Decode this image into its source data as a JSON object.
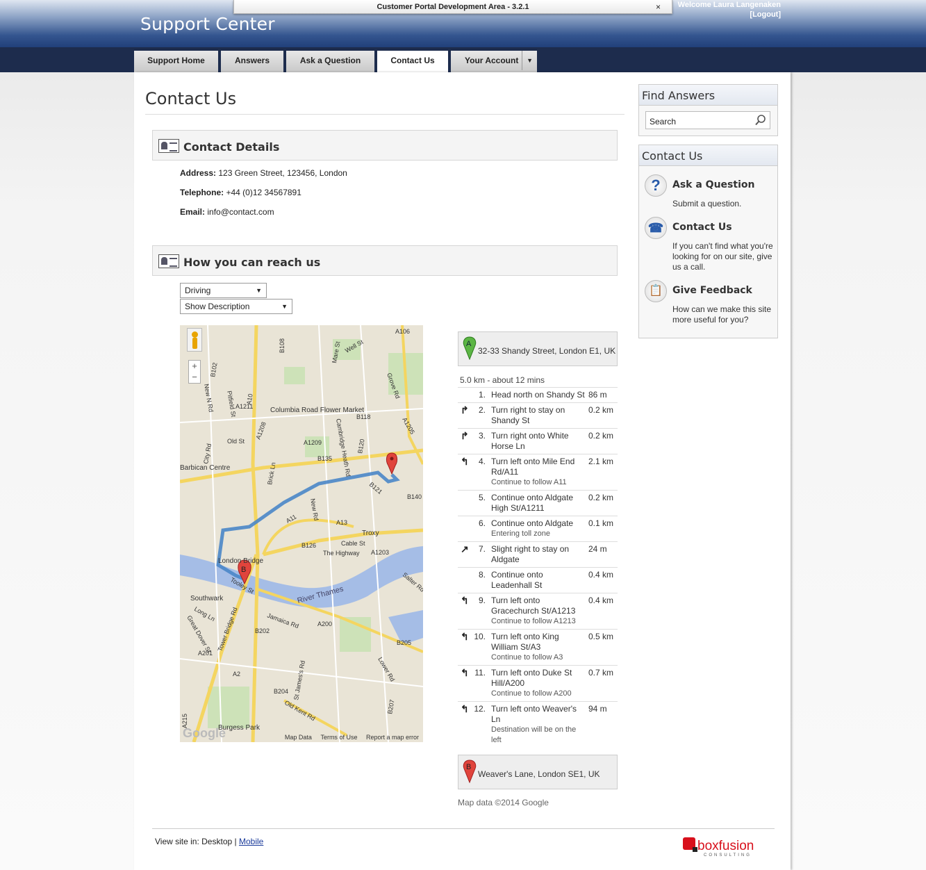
{
  "header": {
    "brand": "Support Center",
    "dev_title": "Customer Portal Development Area - 3.2.1",
    "dev_close": "×",
    "welcome": "Welcome Laura Langenaken",
    "logout": "[Logout]"
  },
  "nav": {
    "tabs": [
      {
        "label": "Support Home"
      },
      {
        "label": "Answers"
      },
      {
        "label": "Ask a Question"
      },
      {
        "label": "Contact Us"
      },
      {
        "label": "Your Account"
      }
    ],
    "active": "Contact Us"
  },
  "page": {
    "title": "Contact Us"
  },
  "contact": {
    "heading": "Contact Details",
    "address_label": "Address:",
    "address": "123 Green Street, 123456, London",
    "phone_label": "Telephone:",
    "phone": "+44 (0)12 34567891",
    "email_label": "Email:",
    "email": "info@contact.com"
  },
  "reach": {
    "heading": "How you can reach us",
    "mode": "Driving",
    "desc": "Show Description"
  },
  "map": {
    "labels": [
      "Columbia Road Flower Market",
      "Barbican Centre",
      "London Bridge",
      "Southwark",
      "Troxy",
      "River Thames",
      "The Highway",
      "Cable St",
      "Burgess Park",
      "Old St",
      "City Rd",
      "Tower Bridge Rd",
      "Jamaica Rd",
      "Long Ln",
      "Lower Rd",
      "Salter Rd",
      "Old Kent Rd",
      "Great Dover St",
      "St James's Rd"
    ],
    "roads": [
      "A10",
      "A1208",
      "A1209",
      "B135",
      "B108",
      "B118",
      "B120",
      "A1205",
      "A106",
      "B102",
      "A11",
      "A13",
      "B126",
      "A1203",
      "B121",
      "B140",
      "B202",
      "A200",
      "B205",
      "A201",
      "A2",
      "B204",
      "B207",
      "A215",
      "A1211",
      "Well St",
      "Mare St",
      "Grove Rd",
      "New N Rd",
      "Pitfield St",
      "Brick Ln",
      "New Rd",
      "Cambridge Heath Rd",
      "Tooley St"
    ],
    "google": "Google",
    "footer": [
      "Map Data",
      "Terms of Use",
      "Report a map error"
    ],
    "marker_b": "B",
    "zoom_in": "+",
    "zoom_out": "−"
  },
  "directions": {
    "start_pin": "A",
    "start": "32-33 Shandy Street, London E1, UK",
    "summary": "5.0 km - about 12 mins",
    "steps": [
      {
        "icon": "",
        "num": "1.",
        "text": "Head north on Shandy St",
        "sub": "",
        "dist": "86 m"
      },
      {
        "icon": "turn-right-icon",
        "num": "2.",
        "text": "Turn right to stay on Shandy St",
        "sub": "",
        "dist": "0.2 km"
      },
      {
        "icon": "turn-right-icon",
        "num": "3.",
        "text": "Turn right onto White Horse Ln",
        "sub": "",
        "dist": "0.2 km"
      },
      {
        "icon": "turn-left-icon",
        "num": "4.",
        "text": "Turn left onto Mile End Rd/A11",
        "sub": "Continue to follow A11",
        "dist": "2.1 km"
      },
      {
        "icon": "",
        "num": "5.",
        "text": "Continue onto Aldgate High St/A1211",
        "sub": "",
        "dist": "0.2 km"
      },
      {
        "icon": "",
        "num": "6.",
        "text": "Continue onto Aldgate",
        "sub": "Entering toll zone",
        "dist": "0.1 km"
      },
      {
        "icon": "slight-right-icon",
        "num": "7.",
        "text": "Slight right to stay on Aldgate",
        "sub": "",
        "dist": "24 m"
      },
      {
        "icon": "",
        "num": "8.",
        "text": "Continue onto Leadenhall St",
        "sub": "",
        "dist": "0.4 km"
      },
      {
        "icon": "turn-left-icon",
        "num": "9.",
        "text": "Turn left onto Gracechurch St/A1213",
        "sub": "Continue to follow A1213",
        "dist": "0.4 km"
      },
      {
        "icon": "turn-left-icon",
        "num": "10.",
        "text": "Turn left onto King William St/A3",
        "sub": "Continue to follow A3",
        "dist": "0.5 km"
      },
      {
        "icon": "turn-left-icon",
        "num": "11.",
        "text": "Turn left onto Duke St Hill/A200",
        "sub": "Continue to follow A200",
        "dist": "0.7 km"
      },
      {
        "icon": "turn-left-icon",
        "num": "12.",
        "text": "Turn left onto Weaver's Ln",
        "sub": "Destination will be on the left",
        "dist": "94 m"
      }
    ],
    "end_pin": "B",
    "end": "Weaver's Lane, London SE1, UK",
    "mapdata": "Map data ©2014 Google"
  },
  "footer": {
    "view_label": "View site in: Desktop |",
    "mobile": "Mobile",
    "logo_text": "boxfusion",
    "logo_sub": "CONSULTING"
  },
  "sidebar": {
    "find_heading": "Find Answers",
    "search_placeholder": "Search",
    "contact_heading": "Contact Us",
    "items": [
      {
        "icon": "question-icon",
        "name": "Ask a Question",
        "desc": "Submit a question."
      },
      {
        "icon": "phone-icon",
        "name": "Contact Us",
        "desc": "If you can't find what you're looking for on our site, give us a call."
      },
      {
        "icon": "clipboard-icon",
        "name": "Give Feedback",
        "desc": "How can we make this site more useful for you?"
      }
    ]
  },
  "colors": {
    "nav": "#1d2c4d",
    "route": "#4a86c8",
    "marker": "#e0443c",
    "link": "#1a3a9a"
  }
}
